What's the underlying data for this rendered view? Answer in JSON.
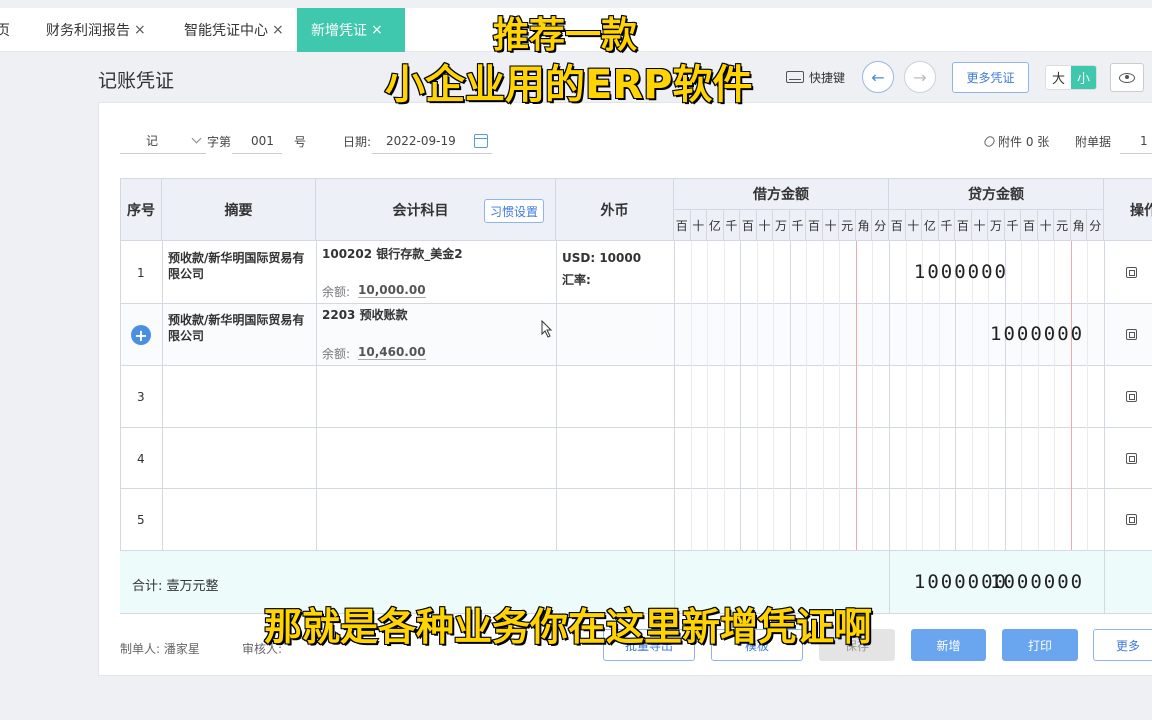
{
  "tabs": [
    {
      "label": "页"
    },
    {
      "label": "财务利润报告"
    },
    {
      "label": "智能凭证中心"
    },
    {
      "label": "新增凭证"
    }
  ],
  "tab_close_glyph": "×",
  "page_title": "记账凭证",
  "header": {
    "shortcut_label": "快捷键",
    "prev_glyph": "←",
    "next_glyph": "→",
    "more_vouchers": "更多凭证",
    "size_large": "大",
    "size_small": "小"
  },
  "meta": {
    "voucher_word": "记",
    "word_no_label": "字第",
    "number": "001",
    "number_suffix": "号",
    "date_label": "日期:",
    "date": "2022-09-19",
    "attachment": "附件 0 张",
    "attach_docs_label": "附单据",
    "attach_docs_value": "1"
  },
  "table": {
    "headers": {
      "seq": "序号",
      "summary": "摘要",
      "account": "会计科目",
      "habit_settings": "习惯设置",
      "foreign": "外币",
      "debit": "借方金额",
      "credit": "贷方金额",
      "ops": "操作"
    },
    "digits": [
      "百",
      "十",
      "亿",
      "千",
      "百",
      "十",
      "万",
      "千",
      "百",
      "十",
      "元",
      "角",
      "分"
    ],
    "rows": [
      {
        "seq": "1",
        "summary_line1": "预收款/新华明国际贸易有",
        "summary_line2": "限公司",
        "account": "100202 银行存款_美金2",
        "balance_label": "余额:",
        "balance": "10,000.00",
        "foreign_line1": "USD:  10000",
        "foreign_line2": "汇率:",
        "debit": "1000000",
        "credit": ""
      },
      {
        "seq": "+",
        "summary_line1": "预收款/新华明国际贸易有",
        "summary_line2": "限公司",
        "account": "2203 预收账款",
        "balance_label": "余额:",
        "balance": "10,460.00",
        "foreign_line1": "",
        "foreign_line2": "",
        "debit": "",
        "credit": "1000000"
      },
      {
        "seq": "3"
      },
      {
        "seq": "4"
      },
      {
        "seq": "5"
      }
    ],
    "total_label": "合计:  壹万元整",
    "total_debit": "1000000",
    "total_credit": "1000000"
  },
  "footer": {
    "preparer": "制单人:  潘家星",
    "reviewer": "审核人:",
    "batch_import": "批量导出",
    "template": "模板",
    "save": "保存",
    "add": "新增",
    "print": "打印",
    "more": "更多"
  },
  "overlay": {
    "top_line1": "推荐一款",
    "top_line2": "小企业用的ERP软件",
    "bottom": "那就是各种业务你在这里新增凭证啊"
  },
  "colors": {
    "accent": "#3fc8ad",
    "primary_button": "#6aa5ef",
    "caption": "#ffd400",
    "total_row_bg": "#eefbfb"
  }
}
